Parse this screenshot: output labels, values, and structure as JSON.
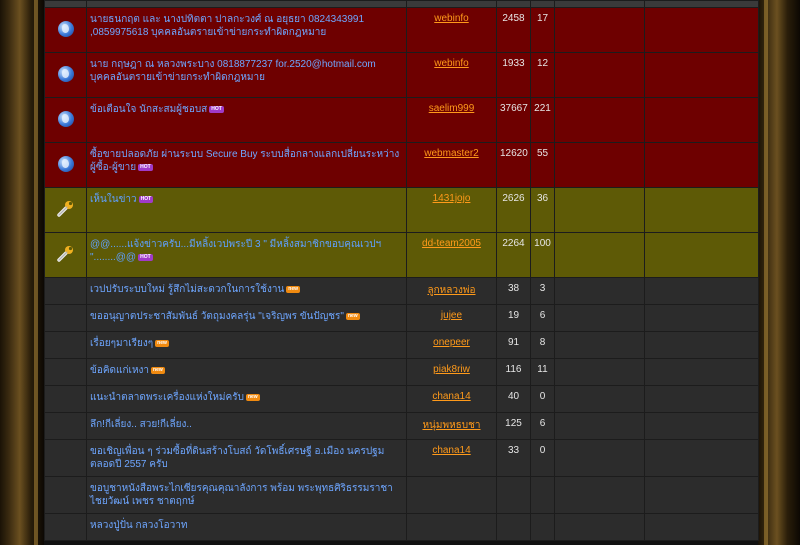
{
  "topics": [
    {
      "kind": "hot",
      "icon": "globe-icon",
      "title": "นายธนกฤต และ นางปทิตตา ปาลกะวงศ์ ณ อยุธยา 0824343991 ,0859975618 บุคคลอันตรายเข้าข่ายกระทำผิดกฎหมาย",
      "badge": "",
      "author": "webinfo",
      "views": "2458",
      "replies": "17"
    },
    {
      "kind": "hot",
      "icon": "globe-icon",
      "title": "นาย กฤษฎา ณ หลวงพระบาง 0818877237 for.2520@hotmail.com บุคคลอันตรายเข้าข่ายกระทำผิดกฎหมาย",
      "badge": "",
      "author": "webinfo",
      "views": "1933",
      "replies": "12"
    },
    {
      "kind": "hot",
      "icon": "globe-icon",
      "title": "ข้อเตือนใจ นักสะสมผู้ชอบส",
      "badge": "HOT",
      "author": "saelim999",
      "views": "37667",
      "replies": "221"
    },
    {
      "kind": "hot",
      "icon": "globe-icon",
      "title": "ซื้อขายปลอดภัย ผ่านระบบ Secure Buy ระบบสื่อกลางแลกเปลี่ยนระหว่างผู้ซื้อ-ผู้ขาย",
      "badge": "HOT",
      "author": "webmaster2",
      "views": "12620",
      "replies": "55"
    },
    {
      "kind": "ann",
      "icon": "wrench-icon",
      "title": "เห็นในข่าว",
      "badge": "HOT",
      "author": "1431jojo",
      "views": "2626",
      "replies": "36"
    },
    {
      "kind": "ann",
      "icon": "wrench-icon",
      "title": "@@......แจ้งข่าวครับ...มีหลิ้งเวปพระปี 3 \" มีหลิ้งสมาชิกขอบคุณเวปฯ \"........@@",
      "badge": "HOT",
      "author": "dd-team2005",
      "views": "2264",
      "replies": "100"
    },
    {
      "kind": "norm",
      "icon": "",
      "title": "เวปปรับระบบใหม่ รู้สึกไม่สะดวกในการใช้งาน",
      "badge": "new",
      "author": "ลูกหลวงพ่อ",
      "views": "38",
      "replies": "3"
    },
    {
      "kind": "norm",
      "icon": "",
      "title": "ขออนุญาตประชาสัมพันธ์ วัตถุมงคลรุ่น \"เจริญพร ขันปัญชร\"",
      "badge": "new",
      "author": "jujee",
      "views": "19",
      "replies": "6"
    },
    {
      "kind": "norm",
      "icon": "",
      "title": "เรื่อยๆมาเรียงๆ",
      "badge": "new",
      "author": "onepeer",
      "views": "91",
      "replies": "8"
    },
    {
      "kind": "norm",
      "icon": "",
      "title": "ข้อคิดแก่เหงา",
      "badge": "new",
      "author": "piak8riw",
      "views": "116",
      "replies": "11"
    },
    {
      "kind": "norm",
      "icon": "",
      "title": "แนะนำตลาดพระเครื่องแห่งใหม่ครับ",
      "badge": "new",
      "author": "chana14",
      "views": "40",
      "replies": "0"
    },
    {
      "kind": "norm",
      "icon": "",
      "title": "ลึก!กีเลี่ยง.. สวย!กีเลี่ยง..",
      "badge": "",
      "author": "หนุ่มพหธบชา",
      "views": "125",
      "replies": "6"
    },
    {
      "kind": "norm",
      "icon": "",
      "title": "ขอเชิญเพื่อน ๆ ร่วมซื้อที่ดินสร้างโบสถ์ วัดโพธิ์เศรษฐี อ.เมือง นครปฐม ตลอดปี 2557 ครับ",
      "badge": "",
      "author": "chana14",
      "views": "33",
      "replies": "0"
    },
    {
      "kind": "norm",
      "icon": "",
      "title": "ขอบูชาหนังสือพระไกเซียรคุณคุณาลังการ พร้อม พระพุทธศิริธรรมราชาไชยวัฒน์ เพชร ชาตฤกษ์",
      "badge": "",
      "author": "",
      "views": "",
      "replies": ""
    },
    {
      "kind": "norm",
      "icon": "",
      "title": "หลวงปู่ปั่น กลวงโอวาท",
      "badge": "",
      "author": "",
      "views": "",
      "replies": ""
    }
  ]
}
